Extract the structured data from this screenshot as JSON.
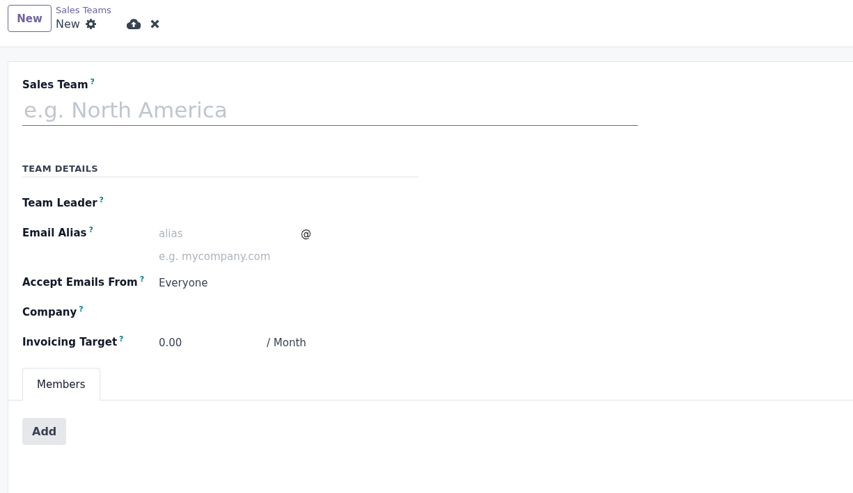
{
  "control_panel": {
    "new_button": "New",
    "breadcrumb": "Sales Teams",
    "record_title": "New"
  },
  "form": {
    "name_field": {
      "label": "Sales Team",
      "help": "?",
      "placeholder": "e.g. North America"
    },
    "section_title": "TEAM DETAILS",
    "fields": [
      {
        "kind": "empty",
        "label": "Team Leader",
        "help": "?"
      },
      {
        "kind": "alias",
        "label": "Email Alias",
        "help": "?",
        "placeholder": "alias",
        "separator": "@",
        "domain_placeholder": "e.g. mycompany.com"
      },
      {
        "kind": "text",
        "label": "Accept Emails From",
        "help": "?",
        "value": "Everyone"
      },
      {
        "kind": "empty",
        "label": "Company",
        "help": "?"
      },
      {
        "kind": "money",
        "label": "Invoicing Target",
        "help": "?",
        "value": "0.00",
        "suffix": "/ Month"
      }
    ],
    "tabs": [
      {
        "label": "Members",
        "selected": true
      }
    ],
    "add_button": "Add"
  }
}
